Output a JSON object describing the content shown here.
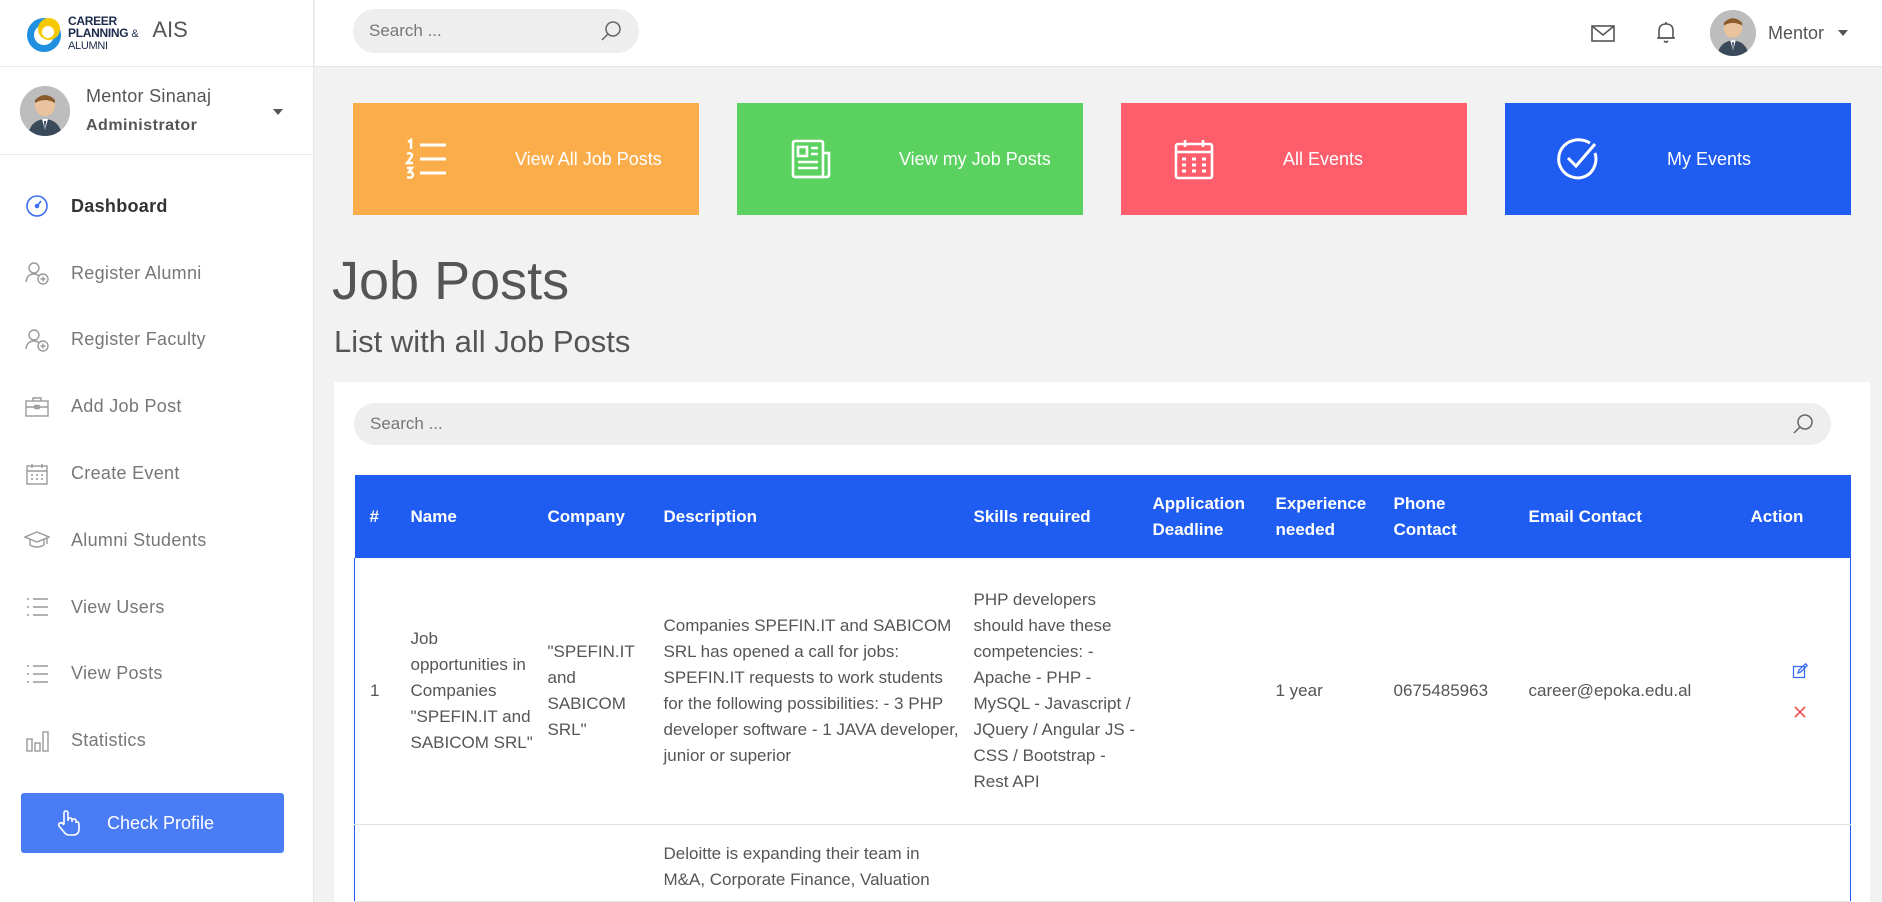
{
  "brand": {
    "logo_lines": [
      "CAREER",
      "PLANNING",
      "ALUMNI"
    ],
    "logo_amp": "&",
    "app_name": "AIS"
  },
  "sidebar": {
    "user_name": "Mentor Sinanaj",
    "user_role": "Administrator",
    "items": [
      {
        "label": "Dashboard",
        "icon": "dashboard-icon"
      },
      {
        "label": "Register Alumni",
        "icon": "user-add-icon"
      },
      {
        "label": "Register Faculty",
        "icon": "user-add-icon"
      },
      {
        "label": "Add Job Post",
        "icon": "briefcase-icon"
      },
      {
        "label": "Create Event",
        "icon": "calendar-icon"
      },
      {
        "label": "Alumni Students",
        "icon": "graduation-cap-icon"
      },
      {
        "label": "View Users",
        "icon": "list-icon"
      },
      {
        "label": "View Posts",
        "icon": "list-icon"
      },
      {
        "label": "Statistics",
        "icon": "bar-chart-icon"
      }
    ],
    "check_profile_label": "Check Profile"
  },
  "topbar": {
    "search_placeholder": "Search ...",
    "user_name": "Mentor"
  },
  "tiles": [
    {
      "label": "View All Job Posts",
      "color": "#fbad4c",
      "icon": "numbered-list-icon"
    },
    {
      "label": "View my Job Posts",
      "color": "#5bd15f",
      "icon": "newspaper-icon"
    },
    {
      "label": "All Events",
      "color": "#fe5d6c",
      "icon": "calendar-icon"
    },
    {
      "label": "My Events",
      "color": "#1f5cf1",
      "icon": "check-circle-icon"
    }
  ],
  "page": {
    "title": "Job Posts",
    "subtitle": "List with all Job Posts",
    "table_search_placeholder": "Search ..."
  },
  "table": {
    "headers": [
      "#",
      "Name",
      "Company",
      "Description",
      "Skills required",
      "Application Deadline",
      "Experience needed",
      "Phone Contact",
      "Email Contact",
      "Action"
    ],
    "rows": [
      {
        "num": "1",
        "name": "Job opportunities in Companies \"SPEFIN.IT and SABICOM SRL\"",
        "company": "\"SPEFIN.IT and SABICOM SRL\"",
        "description": "Companies SPEFIN.IT and SABICOM SRL has opened a call for jobs: SPEFIN.IT requests to work students for the following possibilities: - 3 PHP developer software - 1 JAVA developer, junior or superior",
        "skills": "PHP developers should have these competencies: - Apache - PHP - MySQL - Javascript / JQuery / Angular JS - CSS / Bootstrap - Rest API",
        "deadline": "",
        "experience": "1 year",
        "phone": "0675485963",
        "email": "career@epoka.edu.al"
      },
      {
        "num": "",
        "name": "",
        "company": "",
        "description": "Deloitte is expanding their team in M&A, Corporate Finance, Valuation",
        "skills": "",
        "deadline": "",
        "experience": "",
        "phone": "",
        "email": ""
      }
    ]
  },
  "colors": {
    "accent": "#1f5cf1",
    "sidebar_button": "#4a7cf6",
    "edit": "#3b6ef5",
    "delete": "#f0504f"
  }
}
